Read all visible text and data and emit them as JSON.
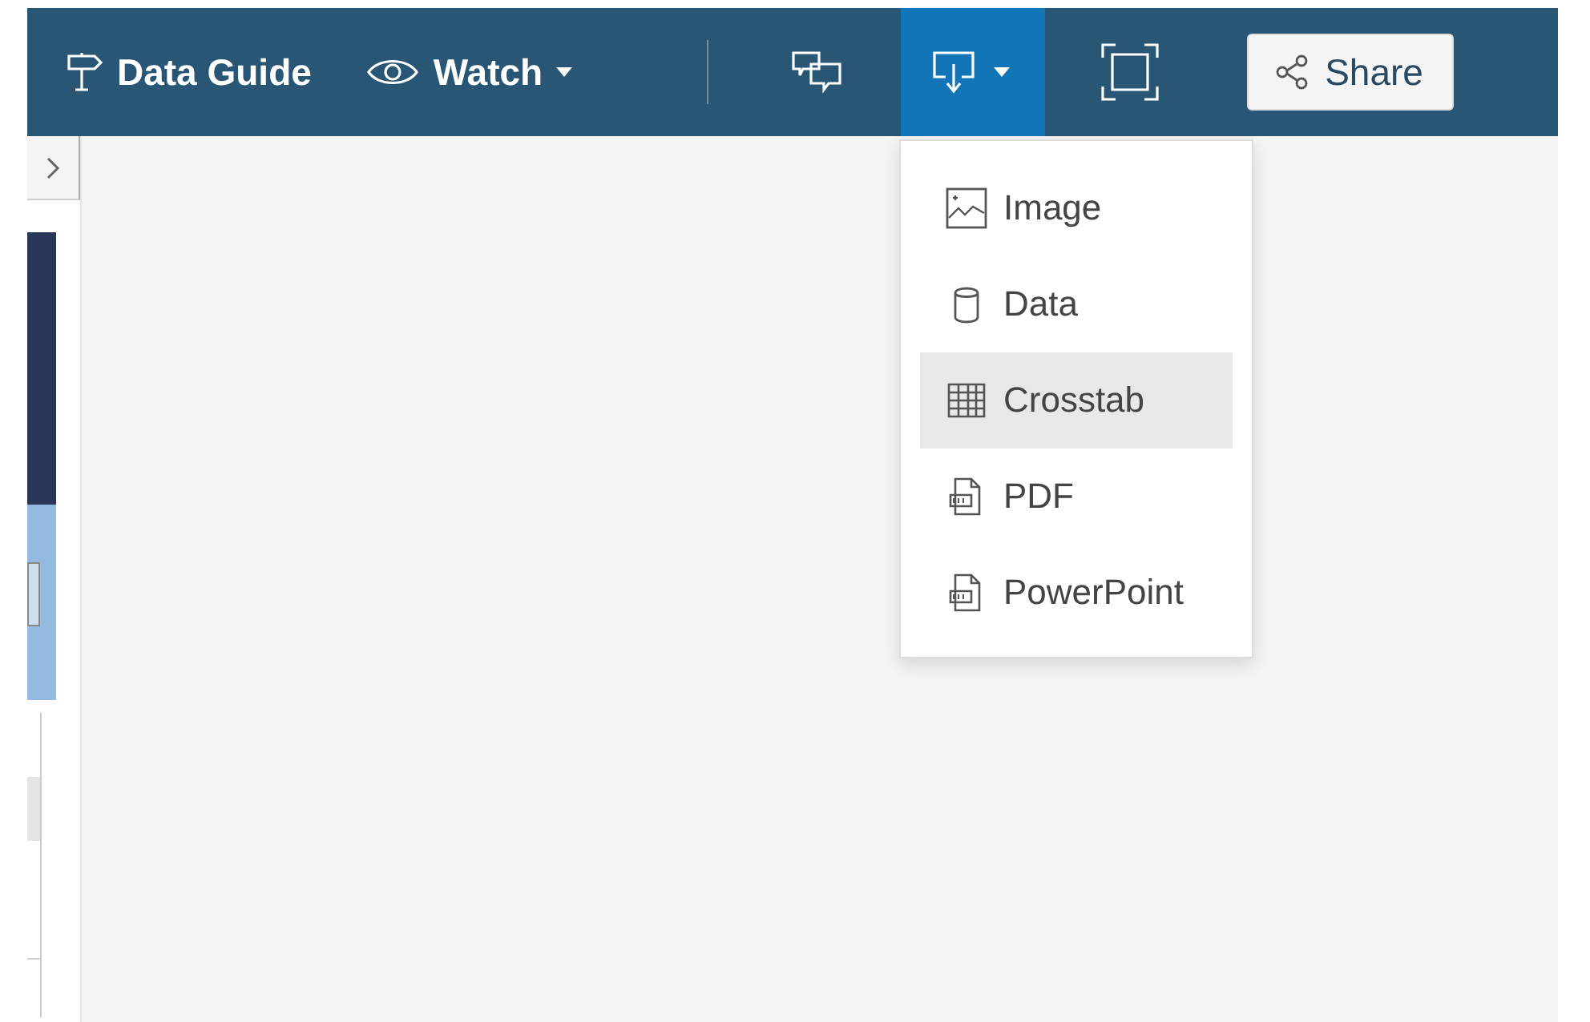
{
  "toolbar": {
    "data_guide": {
      "label": "Data Guide"
    },
    "watch": {
      "label": "Watch"
    },
    "download": {
      "expanded": true
    },
    "share": {
      "label": "Share"
    }
  },
  "download_menu": [
    {
      "kind": "image",
      "label": "Image",
      "selected": false
    },
    {
      "kind": "data",
      "label": "Data",
      "selected": false
    },
    {
      "kind": "crosstab",
      "label": "Crosstab",
      "selected": true
    },
    {
      "kind": "pdf",
      "label": "PDF",
      "selected": false
    },
    {
      "kind": "powerpoint",
      "label": "PowerPoint",
      "selected": false
    }
  ]
}
